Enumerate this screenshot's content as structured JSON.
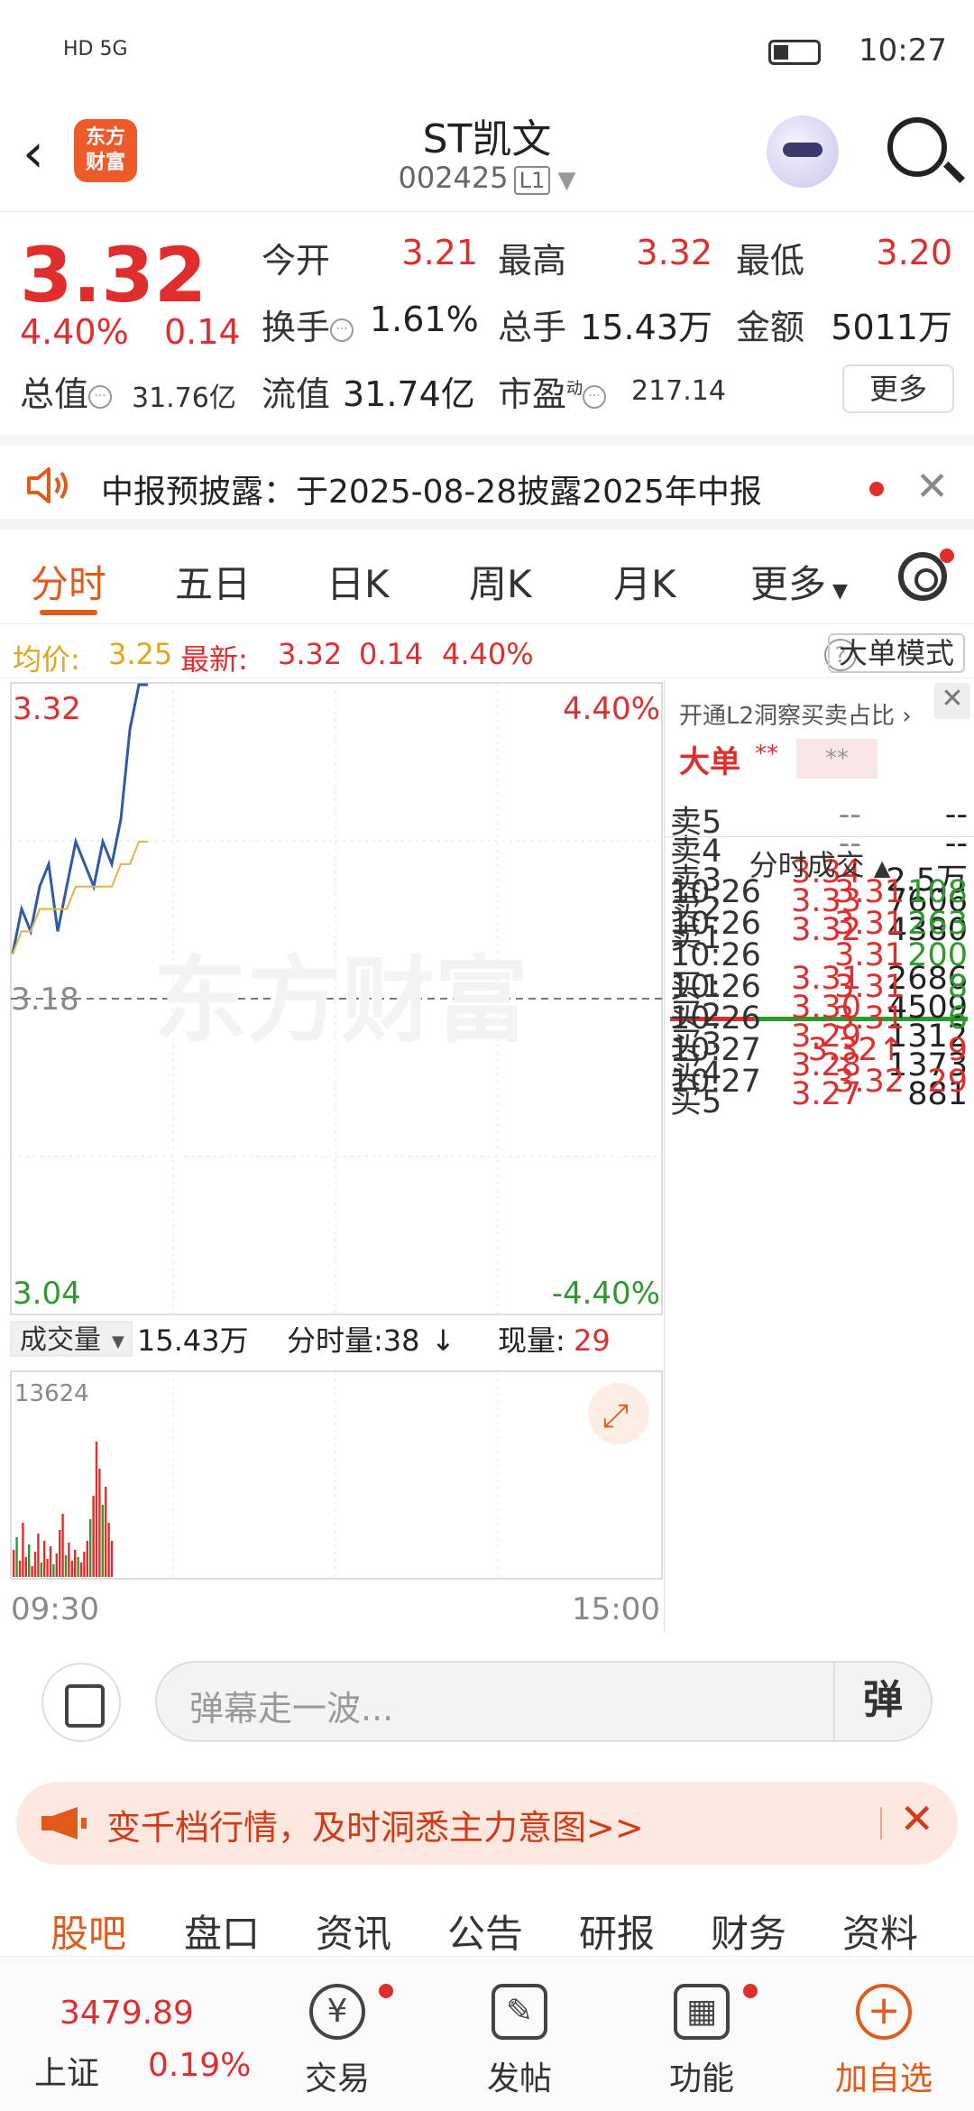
{
  "status": {
    "time": "10:27",
    "network": "HD 5G"
  },
  "header": {
    "title": "ST凯文",
    "code": "002425",
    "level": "L1",
    "logo_text": "东方\n财富"
  },
  "quote": {
    "price": "3.32",
    "pct": "4.40%",
    "chg": "0.14",
    "open_label": "今开",
    "open": "3.21",
    "high_label": "最高",
    "high": "3.32",
    "low_label": "最低",
    "low": "3.20",
    "turnover_label": "换手",
    "turnover": "1.61%",
    "volume_label": "总手",
    "volume": "15.43万",
    "amount_label": "金额",
    "amount": "5011万",
    "mktcap_label": "总值",
    "mktcap": "31.76亿",
    "float_label": "流值",
    "float": "31.74亿",
    "pe_label": "市盈",
    "pe_sup": "动",
    "pe": "217.14",
    "more": "更多"
  },
  "notice": {
    "text": "中报预披露：于2025-08-28披露2025年中报"
  },
  "tabs": [
    "分时",
    "五日",
    "日K",
    "周K",
    "月K",
    "更多"
  ],
  "info": {
    "avg_label": "均价:",
    "avg": "3.25",
    "latest_label": "最新:",
    "latest": "3.32",
    "latest_chg": "0.14",
    "latest_pct": "4.40%",
    "help": "?",
    "mode": "大单模式"
  },
  "chart": {
    "y_top": "3.32",
    "y_mid": "3.18",
    "y_bot": "3.04",
    "pct_top": "4.40%",
    "pct_bot": "-4.40%",
    "watermark": "东方财富",
    "vol_label": "成交量",
    "vol_total": "15.43万",
    "fs_label": "分时量:38",
    "cur_label": "现量:",
    "cur_val": "29",
    "vol_max": "13624",
    "t_start": "09:30",
    "t_end": "15:00"
  },
  "chart_data": {
    "type": "line",
    "series": [
      {
        "values": [
          3.2,
          3.22,
          3.21,
          3.23,
          3.24,
          3.21,
          3.23,
          3.25,
          3.24,
          3.23,
          3.25,
          3.24,
          3.26,
          3.3,
          3.32,
          3.32
        ]
      },
      {
        "values": [
          3.2,
          3.21,
          3.21,
          3.22,
          3.22,
          3.22,
          3.22,
          3.23,
          3.23,
          3.23,
          3.23,
          3.23,
          3.24,
          3.24,
          3.25,
          3.25
        ]
      }
    ],
    "ylim": [
      3.04,
      3.32
    ]
  },
  "book": {
    "promo": "开通L2洞察买卖占比",
    "dadan": "大单",
    "stars": "**",
    "stars2": "**",
    "sells": [
      {
        "label": "卖5",
        "price": "--",
        "vol": "--"
      },
      {
        "label": "卖4",
        "price": "--",
        "vol": "--"
      },
      {
        "label": "卖3",
        "price": "3.34",
        "vol": "2.5万"
      },
      {
        "label": "卖2",
        "price": "3.33",
        "vol": "7606"
      },
      {
        "label": "卖1",
        "price": "3.32",
        "vol": "4380"
      }
    ],
    "buys": [
      {
        "label": "买1",
        "price": "3.31",
        "vol": "2686"
      },
      {
        "label": "买2",
        "price": "3.30",
        "vol": "4509"
      },
      {
        "label": "买3",
        "price": "3.29",
        "vol": "1312"
      },
      {
        "label": "买4",
        "price": "3.28",
        "vol": "1373"
      },
      {
        "label": "买5",
        "price": "3.27",
        "vol": "881"
      }
    ],
    "ticks_title": "分时成交",
    "ticks": [
      {
        "t": "10:26",
        "p": "3.31",
        "v": "108",
        "c": "green"
      },
      {
        "t": "10:26",
        "p": "3.31",
        "v": "263",
        "c": "green"
      },
      {
        "t": "10:26",
        "p": "3.31",
        "v": "200",
        "c": "green"
      },
      {
        "t": "10:26",
        "p": "3.31",
        "v": "8",
        "c": "green"
      },
      {
        "t": "10:26",
        "p": "3.31",
        "v": "6",
        "c": "green"
      },
      {
        "t": "10:27",
        "p": "3.32↑",
        "v": "9",
        "c": "red"
      },
      {
        "t": "10:27",
        "p": "3.32",
        "v": "29",
        "c": "red"
      }
    ]
  },
  "comment": {
    "placeholder": "弹幕走一波...",
    "dan": "弹"
  },
  "promo": {
    "text": "变千档行情，及时洞悉主力意图>>"
  },
  "subtabs": [
    "股吧",
    "盘口",
    "资讯",
    "公告",
    "研报",
    "财务",
    "资料"
  ],
  "bottom": {
    "index_value": "3479.89",
    "index_name": "上证",
    "index_pct": "0.19%",
    "nav": [
      "交易",
      "发帖",
      "功能",
      "加自选"
    ]
  }
}
